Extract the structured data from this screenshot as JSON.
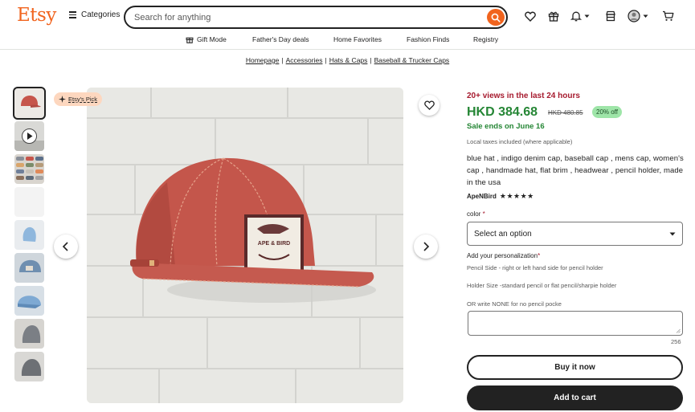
{
  "header": {
    "logo": "Etsy",
    "categories_label": "Categories",
    "search_placeholder": "Search for anything"
  },
  "subnav": [
    {
      "label": "Gift Mode"
    },
    {
      "label": "Father's Day deals"
    },
    {
      "label": "Home Favorites"
    },
    {
      "label": "Fashion Finds"
    },
    {
      "label": "Registry"
    }
  ],
  "breadcrumb": [
    "Homepage",
    "Accessories",
    "Hats & Caps",
    "Baseball & Trucker Caps"
  ],
  "gallery": {
    "badge": "Etsy's Pick"
  },
  "product": {
    "views": "20+ views in the last 24 hours",
    "price": "HKD 384.68",
    "old_price": "HKD 480.85",
    "discount": "20% off",
    "sale_ends": "Sale ends on June 16",
    "taxes": "Local taxes included (where applicable)",
    "title": "blue hat , indigo denim cap, baseball cap , mens cap, women's cap , handmade hat, flat brim , headwear , pencil holder, made in the usa",
    "shop": "ApeNBird",
    "stars": "★★★★★",
    "rating": 5
  },
  "options": {
    "color_label": "color",
    "color_required": "*",
    "select_placeholder": "Select an option",
    "personalization_label": "Add your personalization",
    "personalization_required": "*",
    "instructions": [
      "Pencil Side - right or left hand side for pencil holder",
      "Holder Size -standard pencil or flat pencil/sharpie holder",
      "OR write NONE for no pencil pocke"
    ],
    "char_count": "256"
  },
  "actions": {
    "buy_now": "Buy it now",
    "add_to_cart": "Add to cart"
  },
  "colors": {
    "brand": "#f1641e",
    "price_green": "#258635",
    "views_red": "#a61a2e",
    "discount_bg": "#9ee5a8"
  }
}
